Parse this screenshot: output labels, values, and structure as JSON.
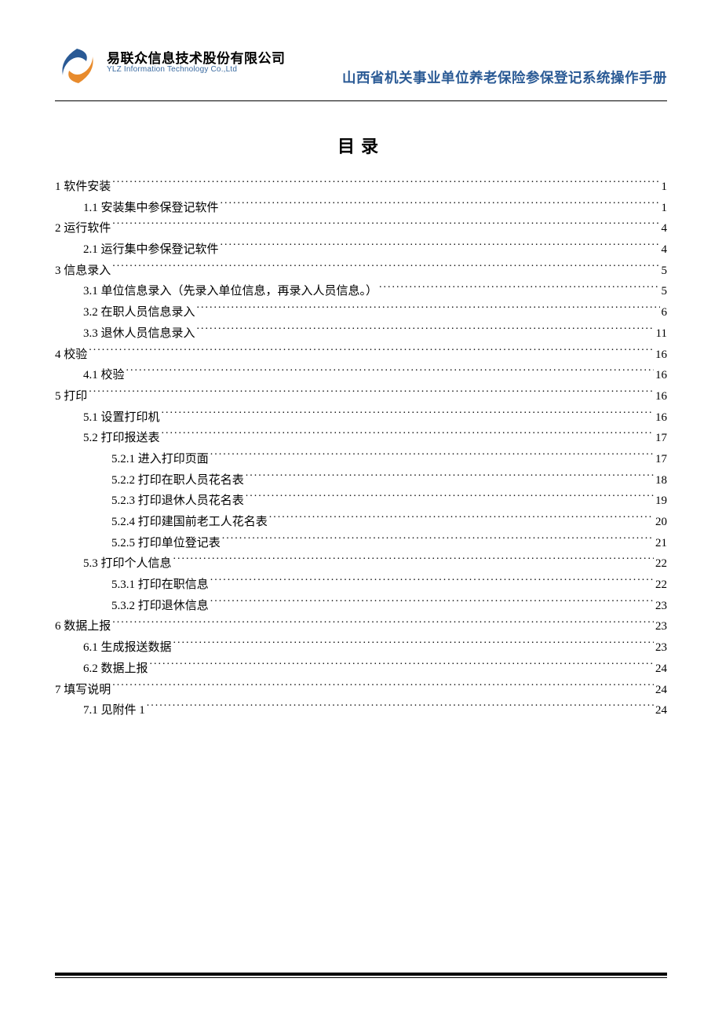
{
  "header": {
    "company_cn": "易联众信息技术股份有限公司",
    "company_en": "YLZ Information Technology Co.,Ltd",
    "doc_title": "山西省机关事业单位养老保险参保登记系统操作手册"
  },
  "toc_title": "目录",
  "toc": [
    {
      "level": 1,
      "label": "1  软件安装",
      "page": "1"
    },
    {
      "level": 2,
      "label": "1.1  安装集中参保登记软件",
      "page": "1"
    },
    {
      "level": 1,
      "label": "2  运行软件",
      "page": "4"
    },
    {
      "level": 2,
      "label": "2.1  运行集中参保登记软件",
      "page": "4"
    },
    {
      "level": 1,
      "label": "3  信息录入",
      "page": "5"
    },
    {
      "level": 2,
      "label": "3.1  单位信息录入（先录入单位信息，再录入人员信息。）",
      "page": "5"
    },
    {
      "level": 2,
      "label": "3.2  在职人员信息录入",
      "page": "6"
    },
    {
      "level": 2,
      "label": "3.3  退休人员信息录入",
      "page": "11"
    },
    {
      "level": 1,
      "label": "4  校验",
      "page": "16"
    },
    {
      "level": 2,
      "label": "4.1  校验",
      "page": "16"
    },
    {
      "level": 1,
      "label": "5  打印",
      "page": "16"
    },
    {
      "level": 2,
      "label": "5.1  设置打印机",
      "page": "16"
    },
    {
      "level": 2,
      "label": "5.2  打印报送表",
      "page": "17"
    },
    {
      "level": 3,
      "label": "5.2.1  进入打印页面",
      "page": "17"
    },
    {
      "level": 3,
      "label": "5.2.2  打印在职人员花名表",
      "page": "18"
    },
    {
      "level": 3,
      "label": "5.2.3  打印退休人员花名表",
      "page": "19"
    },
    {
      "level": 3,
      "label": "5.2.4  打印建国前老工人花名表",
      "page": "20"
    },
    {
      "level": 3,
      "label": "5.2.5  打印单位登记表",
      "page": "21"
    },
    {
      "level": 2,
      "label": "5.3  打印个人信息",
      "page": "22"
    },
    {
      "level": 3,
      "label": "5.3.1  打印在职信息",
      "page": "22"
    },
    {
      "level": 3,
      "label": "5.3.2  打印退休信息",
      "page": "23"
    },
    {
      "level": 1,
      "label": "6  数据上报",
      "page": "23"
    },
    {
      "level": 2,
      "label": "6.1  生成报送数据",
      "page": "23"
    },
    {
      "level": 2,
      "label": "6.2  数据上报",
      "page": "24"
    },
    {
      "level": 1,
      "label": "7  填写说明",
      "page": "24"
    },
    {
      "level": 2,
      "label": "7.1  见附件 1",
      "page": "24"
    }
  ]
}
